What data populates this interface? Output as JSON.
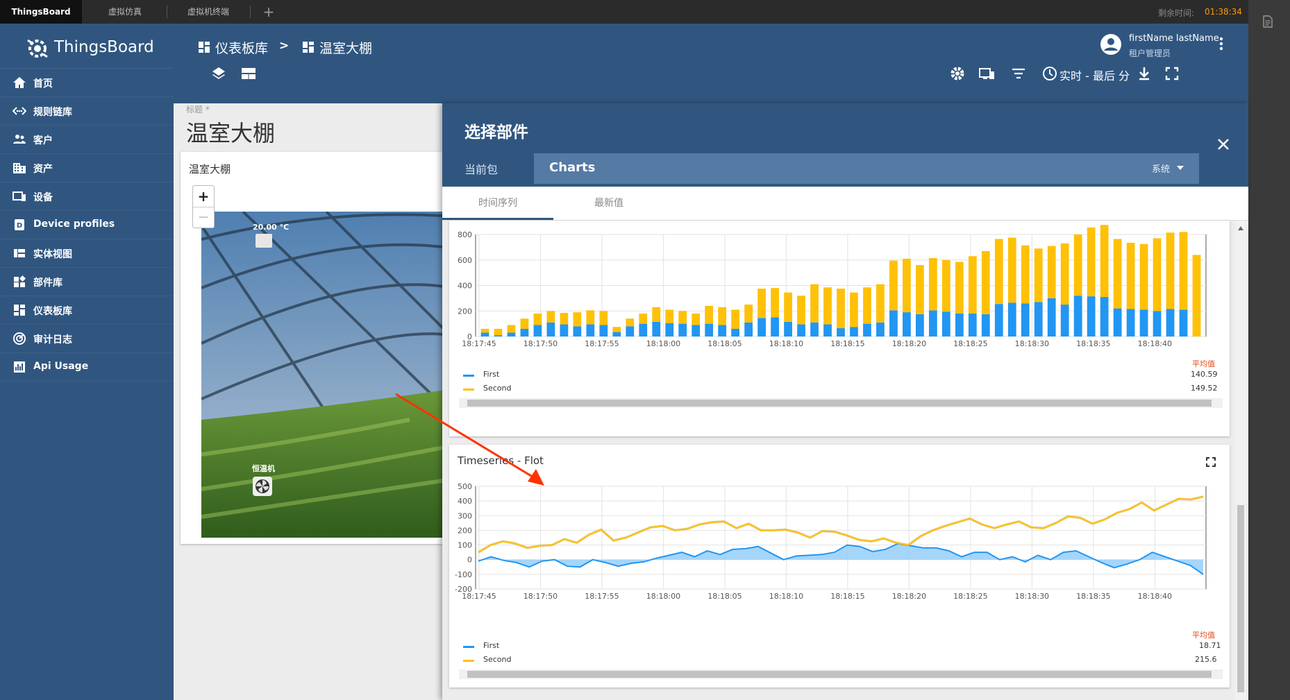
{
  "browser": {
    "tabs": [
      {
        "label": "ThingsBoard"
      },
      {
        "label": "虚拟仿真"
      },
      {
        "label": "虚拟机终端"
      }
    ],
    "new_tab": "+",
    "timer_label": "剩余时间:",
    "timer_value": "01:38:34"
  },
  "app": {
    "brand": "ThingsBoard",
    "breadcrumb": [
      {
        "label": "仪表板库"
      },
      {
        "label": "温室大棚"
      }
    ],
    "breadcrumb_sep": ">",
    "user_name": "firstName lastName",
    "user_role": "租户管理员",
    "timewindow_label": "实时 - 最后 分"
  },
  "sidebar": {
    "items": [
      {
        "label": "首页",
        "icon": "home-icon"
      },
      {
        "label": "规则链库",
        "icon": "rule-chain-icon"
      },
      {
        "label": "客户",
        "icon": "customers-icon"
      },
      {
        "label": "资产",
        "icon": "assets-icon"
      },
      {
        "label": "设备",
        "icon": "devices-icon"
      },
      {
        "label": "Device profiles",
        "icon": "device-profile-icon"
      },
      {
        "label": "实体视图",
        "icon": "entity-view-icon"
      },
      {
        "label": "部件库",
        "icon": "widgets-icon"
      },
      {
        "label": "仪表板库",
        "icon": "dashboard-icon"
      },
      {
        "label": "审计日志",
        "icon": "audit-icon"
      },
      {
        "label": "Api Usage",
        "icon": "api-usage-icon"
      }
    ]
  },
  "dashboard": {
    "caption": "标题 *",
    "title": "温室大棚",
    "widget_title": "温室大棚",
    "temp_label": "20.00 °C",
    "fan_label": "恒温机",
    "zoom_in": "+",
    "zoom_out": "—"
  },
  "dialog": {
    "title": "选择部件",
    "current_bundle_label": "当前包",
    "bundle_value": "Charts",
    "bundle_scope": "系统",
    "tabs": [
      {
        "label": "时间序列"
      },
      {
        "label": "最新值"
      }
    ],
    "widget2_title": "Timeseries - Flot"
  },
  "colors": {
    "sidebar": "#305680",
    "first": "#2196f3",
    "second": "#ffc107",
    "accent_red": "#ff3300"
  },
  "chart_data": [
    {
      "type": "bar",
      "stacked": true,
      "x_ticks": [
        "18:17:45",
        "18:17:50",
        "18:17:55",
        "18:18:00",
        "18:18:05",
        "18:18:10",
        "18:18:15",
        "18:18:20",
        "18:18:25",
        "18:18:30",
        "18:18:35",
        "18:18:40"
      ],
      "y_ticks": [
        "800",
        "600",
        "400",
        "200",
        "0"
      ],
      "ylim": [
        0,
        800
      ],
      "series": [
        {
          "name": "First",
          "values": [
            30,
            10,
            30,
            60,
            90,
            110,
            95,
            80,
            95,
            90,
            35,
            80,
            100,
            115,
            105,
            100,
            90,
            100,
            90,
            60,
            110,
            145,
            150,
            115,
            95,
            110,
            95,
            65,
            75,
            100,
            110,
            205,
            190,
            175,
            205,
            195,
            180,
            180,
            175,
            255,
            265,
            260,
            270,
            300,
            250,
            320,
            315,
            310,
            220,
            215,
            210,
            200,
            215,
            210
          ],
          "color": "#2196f3"
        },
        {
          "name": "Second",
          "values": [
            30,
            50,
            60,
            80,
            90,
            90,
            90,
            110,
            110,
            110,
            40,
            60,
            80,
            115,
            105,
            100,
            90,
            140,
            140,
            150,
            140,
            230,
            230,
            230,
            225,
            300,
            290,
            310,
            270,
            285,
            300,
            390,
            420,
            385,
            410,
            405,
            405,
            450,
            495,
            510,
            510,
            455,
            420,
            410,
            480,
            480,
            540,
            565,
            545,
            520,
            515,
            570,
            600,
            610,
            640
          ],
          "color": "#ffc107"
        }
      ],
      "legend_header": "平均值",
      "legend": [
        {
          "name": "First",
          "avg": "140.59"
        },
        {
          "name": "Second",
          "avg": "149.52"
        }
      ]
    },
    {
      "type": "line",
      "x_ticks": [
        "18:17:45",
        "18:17:50",
        "18:17:55",
        "18:18:00",
        "18:18:05",
        "18:18:10",
        "18:18:15",
        "18:18:20",
        "18:18:25",
        "18:18:30",
        "18:18:35",
        "18:18:40"
      ],
      "y_ticks": [
        "500",
        "400",
        "300",
        "200",
        "100",
        "0",
        "-100",
        "-200"
      ],
      "ylim": [
        -200,
        500
      ],
      "series": [
        {
          "name": "First",
          "values": [
            -10,
            20,
            -5,
            -20,
            -50,
            -10,
            0,
            -45,
            -50,
            0,
            -20,
            -45,
            -25,
            -15,
            10,
            30,
            50,
            20,
            60,
            35,
            70,
            75,
            90,
            45,
            0,
            25,
            30,
            35,
            50,
            100,
            90,
            55,
            70,
            110,
            95,
            80,
            80,
            60,
            20,
            50,
            50,
            0,
            20,
            -15,
            30,
            0,
            50,
            60,
            20,
            -20,
            -55,
            -30,
            0,
            50,
            20,
            -10,
            -40,
            -100
          ],
          "color": "#2196f3"
        },
        {
          "name": "Second",
          "values": [
            50,
            100,
            125,
            110,
            80,
            95,
            100,
            140,
            115,
            170,
            205,
            130,
            150,
            185,
            220,
            230,
            200,
            210,
            240,
            255,
            260,
            215,
            245,
            200,
            200,
            205,
            185,
            150,
            195,
            190,
            165,
            135,
            125,
            145,
            115,
            100,
            160,
            200,
            230,
            255,
            280,
            240,
            215,
            240,
            260,
            220,
            215,
            250,
            295,
            285,
            245,
            275,
            320,
            345,
            390,
            335,
            375,
            415,
            410,
            430
          ],
          "color": "#ffc107"
        }
      ],
      "legend_header": "平均值",
      "legend": [
        {
          "name": "First",
          "avg": "18.71"
        },
        {
          "name": "Second",
          "avg": "215.6"
        }
      ]
    }
  ]
}
